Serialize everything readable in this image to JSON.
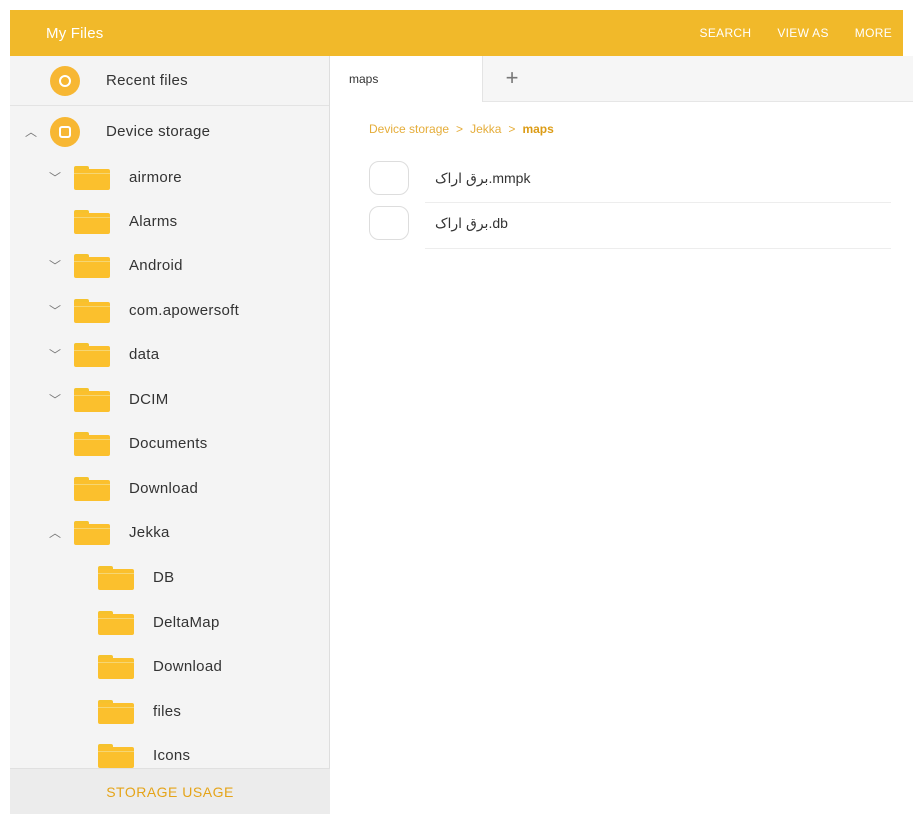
{
  "appbar": {
    "title": "My Files",
    "actions": [
      "SEARCH",
      "VIEW AS",
      "MORE"
    ]
  },
  "sidebar": {
    "recent": {
      "label": "Recent files",
      "icon": "clock-icon"
    },
    "device": {
      "label": "Device storage",
      "icon": "storage-icon",
      "expanded": true
    },
    "folders": [
      {
        "label": "airmore",
        "expandable": true,
        "expanded": false
      },
      {
        "label": "Alarms",
        "expandable": false
      },
      {
        "label": "Android",
        "expandable": true,
        "expanded": false
      },
      {
        "label": "com.apowersoft",
        "expandable": true,
        "expanded": false
      },
      {
        "label": "data",
        "expandable": true,
        "expanded": false
      },
      {
        "label": "DCIM",
        "expandable": true,
        "expanded": false
      },
      {
        "label": "Documents",
        "expandable": false
      },
      {
        "label": "Download",
        "expandable": false
      },
      {
        "label": "Jekka",
        "expandable": true,
        "expanded": true
      }
    ],
    "subfolders": [
      {
        "label": "DB"
      },
      {
        "label": "DeltaMap"
      },
      {
        "label": "Download"
      },
      {
        "label": "files"
      },
      {
        "label": "Icons"
      }
    ],
    "storage_usage": "STORAGE USAGE"
  },
  "tabs": {
    "active": "maps",
    "add_icon": "plus-icon"
  },
  "breadcrumb": {
    "items": [
      "Device storage",
      "Jekka",
      "maps"
    ],
    "separator": ">"
  },
  "files": [
    {
      "name": "برق اراک.mmpk"
    },
    {
      "name": "برق اراک.db"
    }
  ],
  "colors": {
    "accent": "#f1b92a",
    "folder": "#fbc02d",
    "breadcrumb": "#e5ad3a"
  }
}
